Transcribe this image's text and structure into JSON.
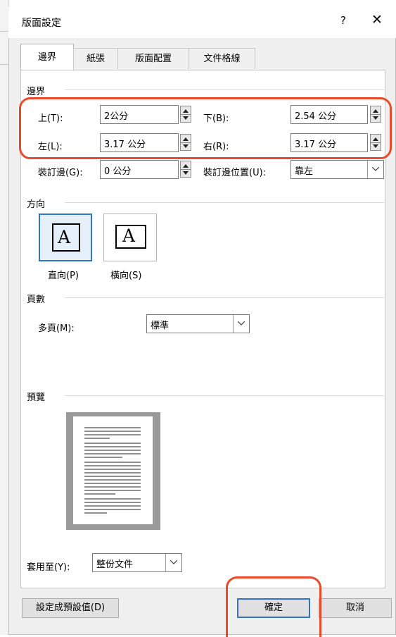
{
  "dialog": {
    "title": "版面設定",
    "help_label": "?",
    "close_label": "✕"
  },
  "tabs": [
    {
      "label": "邊界",
      "active": true
    },
    {
      "label": "紙張",
      "active": false
    },
    {
      "label": "版面配置",
      "active": false
    },
    {
      "label": "文件格線",
      "active": false
    }
  ],
  "margins": {
    "section_label": "邊界",
    "top": {
      "label": "上(T):",
      "value": "2公分"
    },
    "bottom": {
      "label": "下(B):",
      "value": "2.54 公分"
    },
    "left": {
      "label": "左(L):",
      "value": "3.17 公分"
    },
    "right": {
      "label": "右(R):",
      "value": "3.17 公分"
    },
    "gutter": {
      "label": "裝訂邊(G):",
      "value": "0 公分"
    },
    "gutter_position": {
      "label": "裝訂邊位置(U):",
      "value": "靠左"
    }
  },
  "orientation": {
    "section_label": "方向",
    "portrait_label": "直向(P)",
    "landscape_label": "橫向(S)",
    "icon_letter": "A",
    "selected": "portrait"
  },
  "pages": {
    "section_label": "頁數",
    "multiple_label": "多頁(M):",
    "multiple_value": "標準"
  },
  "preview": {
    "section_label": "預覽",
    "apply_to_label": "套用至(Y):",
    "apply_to_value": "整份文件"
  },
  "buttons": {
    "set_default": "設定成預設值(D)",
    "ok": "確定",
    "cancel": "取消"
  },
  "colors": {
    "highlight": "#e74c2a",
    "accent": "#2f74c8"
  }
}
